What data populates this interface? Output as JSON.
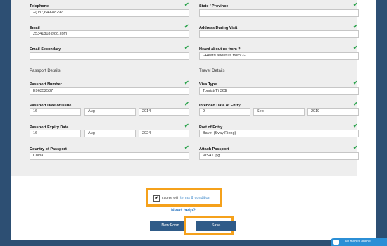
{
  "form": {
    "telephone": {
      "label": "Telephone",
      "value": "+(037)649-88297"
    },
    "state": {
      "label": "State / Province",
      "value": ""
    },
    "email": {
      "label": "Email",
      "value": "25341818@qq.com"
    },
    "address_visit": {
      "label": "Address During Visit",
      "value": ""
    },
    "email_secondary": {
      "label": "Email Secondary",
      "value": ""
    },
    "heard": {
      "label": "Heard about us from ?",
      "value": "--Heard about us from ?--"
    },
    "passport_section": "Passport Details",
    "travel_section": "Travel Details",
    "passport_number": {
      "label": "Passport Number",
      "value": "E96352587"
    },
    "visa_type": {
      "label": "Visa Type",
      "value": "Tourist(T) 36$"
    },
    "passport_issue": {
      "label": "Passport Date of Issue",
      "day": "16",
      "month": "Aug",
      "year": "2014"
    },
    "entry_date": {
      "label": "Intended Date of Entry",
      "day": "9",
      "month": "Sep",
      "year": "2019"
    },
    "passport_expiry": {
      "label": "Passport Expiry Date",
      "day": "16",
      "month": "Aug",
      "year": "2024"
    },
    "port_entry": {
      "label": "Port of Entry",
      "value": "Bavet (Svay Rieng)"
    },
    "country_passport": {
      "label": "Country of Passport",
      "value": "China"
    },
    "attach_passport": {
      "label": "Attach Passport",
      "value": "VISA1.jpg"
    }
  },
  "agree": {
    "prefix": "I agree with",
    "link": "terms & condition",
    "checkmark": "✔"
  },
  "need_help": "Need help?",
  "buttons": {
    "new_form": "New Form",
    "save": "Save"
  },
  "live_help": "Live help is online...",
  "valid_check": "✔",
  "colors": {
    "accent": "#f5a11b",
    "button": "#2f5b88",
    "check": "#2ea44f",
    "link": "#3a86c8"
  },
  "icons": {
    "valid": "checkmark-icon",
    "live_help": "chat-bubble-icon"
  }
}
